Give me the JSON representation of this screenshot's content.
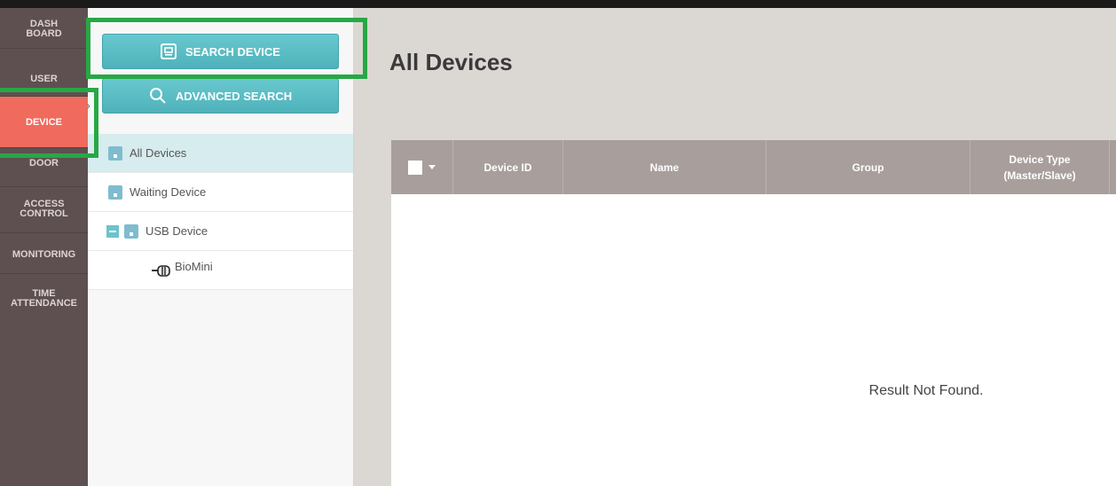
{
  "nav": {
    "items": [
      {
        "line1": "DASH",
        "line2": "BOARD"
      },
      {
        "line1": "USER",
        "line2": ""
      },
      {
        "line1": "DEVICE",
        "line2": ""
      },
      {
        "line1": "DOOR",
        "line2": ""
      },
      {
        "line1": "ACCESS",
        "line2": "CONTROL"
      },
      {
        "line1": "MONITORING",
        "line2": ""
      },
      {
        "line1": "TIME",
        "line2": "ATTENDANCE"
      }
    ],
    "active": "DEVICE"
  },
  "panel": {
    "search_button": "SEARCH DEVICE",
    "advanced_button": "ADVANCED SEARCH",
    "tree": [
      "All Devices",
      "Waiting Device",
      "USB Device",
      "BioMini"
    ]
  },
  "main": {
    "title": "All Devices",
    "columns": [
      "Device ID",
      "Name",
      "Group",
      "Device Type\n(Master/Slave)"
    ],
    "empty_message": "Result Not Found."
  },
  "colors": {
    "accent": "#f06a5e",
    "button": "#5bbdc5",
    "highlight": "#27a845"
  }
}
